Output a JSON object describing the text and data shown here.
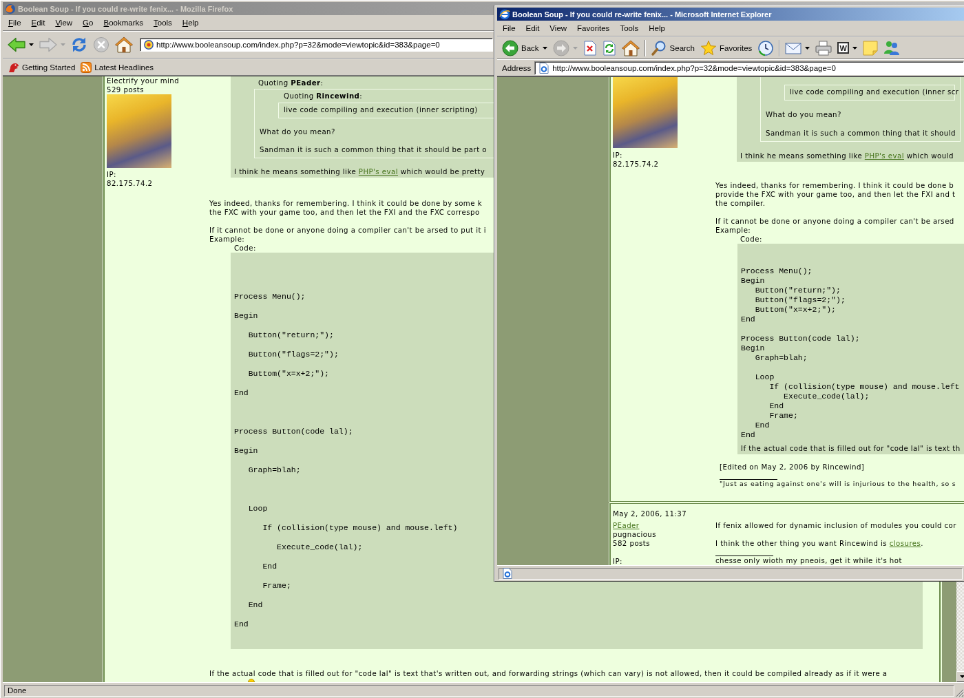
{
  "firefox_window": {
    "active": false,
    "title": "Boolean Soup - If you could re-write fenix... - Mozilla Firefox",
    "menu": [
      "File",
      "Edit",
      "View",
      "Go",
      "Bookmarks",
      "Tools",
      "Help"
    ],
    "toolbar": [
      {
        "kind": "back",
        "disabled": false,
        "dropdown": true
      },
      {
        "kind": "forward",
        "disabled": true,
        "dropdown": true
      },
      {
        "kind": "reload",
        "disabled": false,
        "dropdown": false
      },
      {
        "kind": "stop",
        "disabled": true,
        "dropdown": false
      },
      {
        "kind": "home",
        "disabled": false,
        "dropdown": false
      }
    ],
    "address": "http://www.booleansoup.com/index.php?p=32&mode=viewtopic&id=383&page=0",
    "bookmarks": [
      {
        "kind": "start",
        "label": "Getting Started"
      },
      {
        "kind": "feed",
        "label": "Latest Headlines"
      }
    ],
    "page": {
      "post": {
        "user": {
          "rank": "Electrify your mind",
          "posts": "529 posts",
          "ip_label": "IP:",
          "ip": "82.175.74.2"
        },
        "quote": {
          "heading": "Quoting **PEader**:",
          "inner_heading": "Quoting **Rincewind**:",
          "inner_text": "live code compiling and execution (inner scripting)",
          "paragraphs": [
            "What do you mean?",
            "Sandman it is such a common thing that it should be part o"
          ],
          "reply": [
            {
              "kind": "text",
              "text": "I think he means something like "
            },
            {
              "kind": "link",
              "text": "PHP's eval"
            },
            {
              "kind": "text",
              "text": " which would be pretty"
            }
          ]
        },
        "paragraphs": [
          [
            "Yes indeed, thanks for remembering. I think it could be done by some k",
            "the FXC with your game too, and then let the FXI and the FXC correspo"
          ],
          [
            "If it cannot be done or anyone doing a compiler can't be arsed to put it i",
            "Example:"
          ]
        ],
        "code_label": "Code:",
        "code": "Process Menu();\nBegin\n   Button(\"return;\");\n   Button(\"flags=2;\");\n   Buttom(\"x=x+2;\");\nEnd\n\nProcess Button(code lal);\nBegin\n   Graph=blah;\n\n   Loop\n      If (collision(type mouse) and mouse.left)\n         Execute_code(lal);\n      End\n      Frame;\n   End\nEnd",
        "after_code": "If the actual code that is filled out for \"code lal\" is text that's written out, and forwarding strings (which can vary) is not allowed, then it could be compiled already as if it were a"
      }
    },
    "status": "Done"
  },
  "explorer_window": {
    "active": true,
    "title": "Boolean Soup - If you could re-write fenix... - Microsoft Internet Explorer",
    "menu": [
      "File",
      "Edit",
      "View",
      "Favorites",
      "Tools",
      "Help"
    ],
    "toolbar": [
      {
        "kind": "back",
        "label": "Back",
        "disabled": false,
        "dropdown": true
      },
      {
        "kind": "forward",
        "disabled": true,
        "dropdown": true
      },
      {
        "kind": "stop",
        "disabled": false,
        "dropdown": false
      },
      {
        "kind": "refresh",
        "disabled": false,
        "dropdown": false
      },
      {
        "kind": "home",
        "disabled": false,
        "dropdown": false
      },
      {
        "kind": "separator"
      },
      {
        "kind": "search",
        "label": "Search",
        "disabled": false,
        "dropdown": false
      },
      {
        "kind": "favorites",
        "label": "Favorites",
        "disabled": false,
        "dropdown": false
      },
      {
        "kind": "history",
        "disabled": false,
        "dropdown": false
      },
      {
        "kind": "separator"
      },
      {
        "kind": "mail",
        "disabled": false,
        "dropdown": true
      },
      {
        "kind": "print",
        "disabled": false,
        "dropdown": false
      },
      {
        "kind": "edit",
        "glyph": "W",
        "disabled": false,
        "dropdown": true
      },
      {
        "kind": "notes",
        "disabled": false,
        "dropdown": false
      },
      {
        "kind": "messenger",
        "disabled": false,
        "dropdown": false
      }
    ],
    "address_label": "Address",
    "address": "http://www.booleansoup.com/index.php?p=32&mode=viewtopic&id=383&page=0",
    "page": {
      "post": {
        "user": {
          "ip_label": "IP:",
          "ip": "82.175.74.2"
        },
        "quote": {
          "inner_text": "live code compiling and execution (inner scr",
          "paragraphs": [
            "What do you mean?",
            "Sandman it is such a common thing that it should"
          ],
          "reply": [
            {
              "kind": "text",
              "text": "I think he means something like "
            },
            {
              "kind": "link",
              "text": "PHP's eval"
            },
            {
              "kind": "text",
              "text": " which would"
            }
          ]
        },
        "paragraphs": [
          [
            "Yes indeed, thanks for remembering. I think it could be done b",
            "provide the FXC with your game too, and then let the FXI and t",
            "the compiler."
          ],
          [
            "If it cannot be done or anyone doing a compiler can't be arsed",
            "Example:"
          ]
        ],
        "code_label": "Code:",
        "code": "Process Menu();\nBegin\n   Button(\"return;\");\n   Button(\"flags=2;\");\n   Buttom(\"x=x+2;\");\nEnd\n\nProcess Button(code lal);\nBegin\n   Graph=blah;\n\n   Loop\n      If (collision(type mouse) and mouse.left\n         Execute_code(lal);\n      End\n      Frame;\n   End\nEnd",
        "after_code": "If the actual code that is filled out for \"code lal\" is text th",
        "edited": "[Edited on May 2, 2006 by Rincewind]",
        "signature": "\"Just as eating against one's will is injurious to the health, so s"
      },
      "next_post": {
        "date": "May 2, 2006, 11:37",
        "author": "PEader",
        "rank": "pugnacious",
        "posts": "582 posts",
        "ip_label": "IP:",
        "paragraphs": [
          [
            {
              "kind": "text",
              "text": "If fenix allowed for dynamic inclusion of modules you could cor"
            }
          ],
          [
            {
              "kind": "text",
              "text": "I think the other thing you want Rincewind is "
            },
            {
              "kind": "link",
              "text": "closures"
            },
            {
              "kind": "text",
              "text": "."
            }
          ]
        ],
        "signature": "chesse only wioth my pneois, get it while it's hot"
      }
    }
  }
}
